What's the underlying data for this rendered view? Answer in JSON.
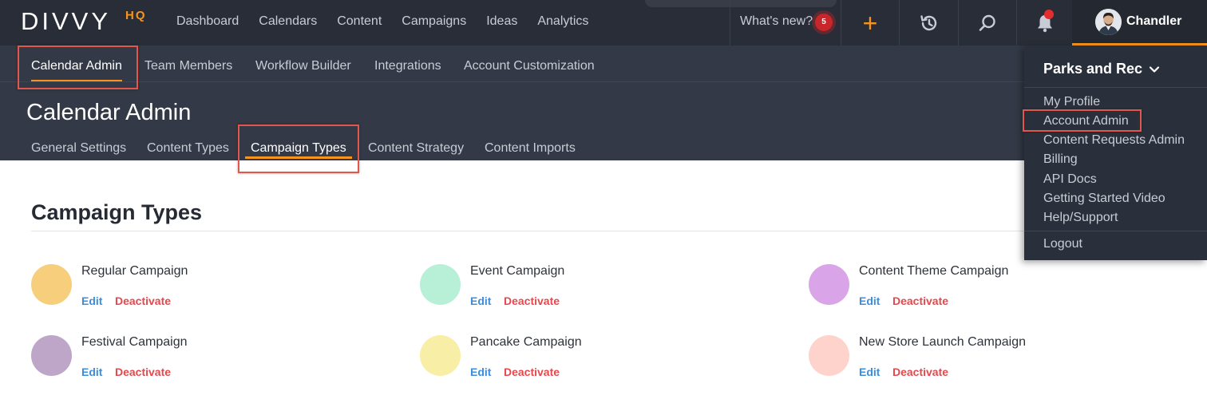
{
  "app": {
    "logo_text": "DIVVY",
    "logo_suffix": "HQ",
    "brand_color": "#f7941d",
    "header_bg": "#282d37",
    "subheader_bg": "#333946",
    "highlight_color": "#e2574c"
  },
  "main_nav": {
    "items": [
      "Dashboard",
      "Calendars",
      "Content",
      "Campaigns",
      "Ideas",
      "Analytics"
    ],
    "whats_new_label": "What's new?",
    "whats_new_count": "5",
    "icons": [
      "plus-icon",
      "history-icon",
      "search-icon",
      "bell-icon"
    ],
    "user_name": "Chandler"
  },
  "admin_nav": {
    "tabs": [
      "Calendar Admin",
      "Team Members",
      "Workflow Builder",
      "Integrations",
      "Account Customization"
    ],
    "active": "Calendar Admin"
  },
  "page": {
    "title": "Calendar Admin",
    "tabs": [
      "General Settings",
      "Content Types",
      "Campaign Types",
      "Content Strategy",
      "Content Imports"
    ],
    "active_tab": "Campaign Types"
  },
  "section": {
    "title": "Campaign Types"
  },
  "campaign_types": [
    {
      "name": "Regular Campaign",
      "color": "#f7cf7c",
      "edit": "Edit",
      "deactivate": "Deactivate"
    },
    {
      "name": "Event Campaign",
      "color": "#b8f0d7",
      "edit": "Edit",
      "deactivate": "Deactivate"
    },
    {
      "name": "Content Theme Campaign",
      "color": "#d9a5e8",
      "edit": "Edit",
      "deactivate": "Deactivate"
    },
    {
      "name": "Festival Campaign",
      "color": "#bda6c7",
      "edit": "Edit",
      "deactivate": "Deactivate"
    },
    {
      "name": "Pancake Campaign",
      "color": "#f9eea6",
      "edit": "Edit",
      "deactivate": "Deactivate"
    },
    {
      "name": "New Store Launch Campaign",
      "color": "#fdd3cc",
      "edit": "Edit",
      "deactivate": "Deactivate"
    }
  ],
  "dropdown": {
    "account_name": "Parks and Rec",
    "items": [
      "My Profile",
      "Account Admin",
      "Content Requests Admin",
      "Billing",
      "API Docs",
      "Getting Started Video",
      "Help/Support"
    ],
    "logout_label": "Logout",
    "highlighted": "Account Admin"
  }
}
